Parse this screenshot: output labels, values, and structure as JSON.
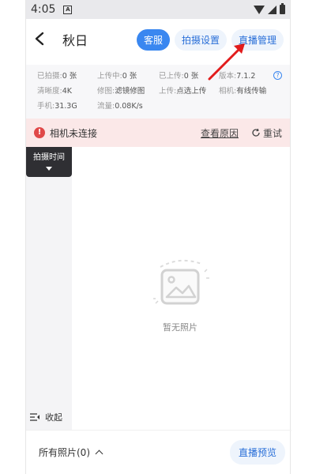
{
  "status": {
    "time": "4:05",
    "indicator": "A"
  },
  "header": {
    "title": "秋日",
    "tabs": [
      {
        "label": "客服",
        "active": true
      },
      {
        "label": "拍摄设置",
        "active": false
      },
      {
        "label": "直播管理",
        "active": false
      }
    ]
  },
  "info": {
    "shot": {
      "label": "已拍摄:",
      "value": "0 张"
    },
    "uploading": {
      "label": "上传中:",
      "value": "0 张"
    },
    "uploaded": {
      "label": "已上传:",
      "value": "0 张"
    },
    "version": {
      "label": "版本:",
      "value": "7.1.2"
    },
    "resolution": {
      "label": "清晰度:",
      "value": "4K"
    },
    "retouch": {
      "label": "修图:",
      "value": "滤镜修图"
    },
    "upload": {
      "label": "上传:",
      "value": "点选上传"
    },
    "camera": {
      "label": "相机:",
      "value": "有线传输"
    },
    "phone": {
      "label": "手机:",
      "value": "31.3G"
    },
    "traffic": {
      "label": "流量:",
      "value": "0.08K/s"
    },
    "help": "?"
  },
  "alert": {
    "text": "相机未连接",
    "link": "查看原因",
    "retry": "重试",
    "icon": "!"
  },
  "sidebar": {
    "filter": "拍摄时间",
    "collapse": "收起"
  },
  "empty": {
    "text": "暂无照片"
  },
  "bottom": {
    "all_photos": "所有照片(0)",
    "preview": "直播预览"
  },
  "colors": {
    "accent": "#3a87f0",
    "alert_bg": "#fbe8e8",
    "alert_icon": "#e04848",
    "annotation": "#e21c1c"
  }
}
